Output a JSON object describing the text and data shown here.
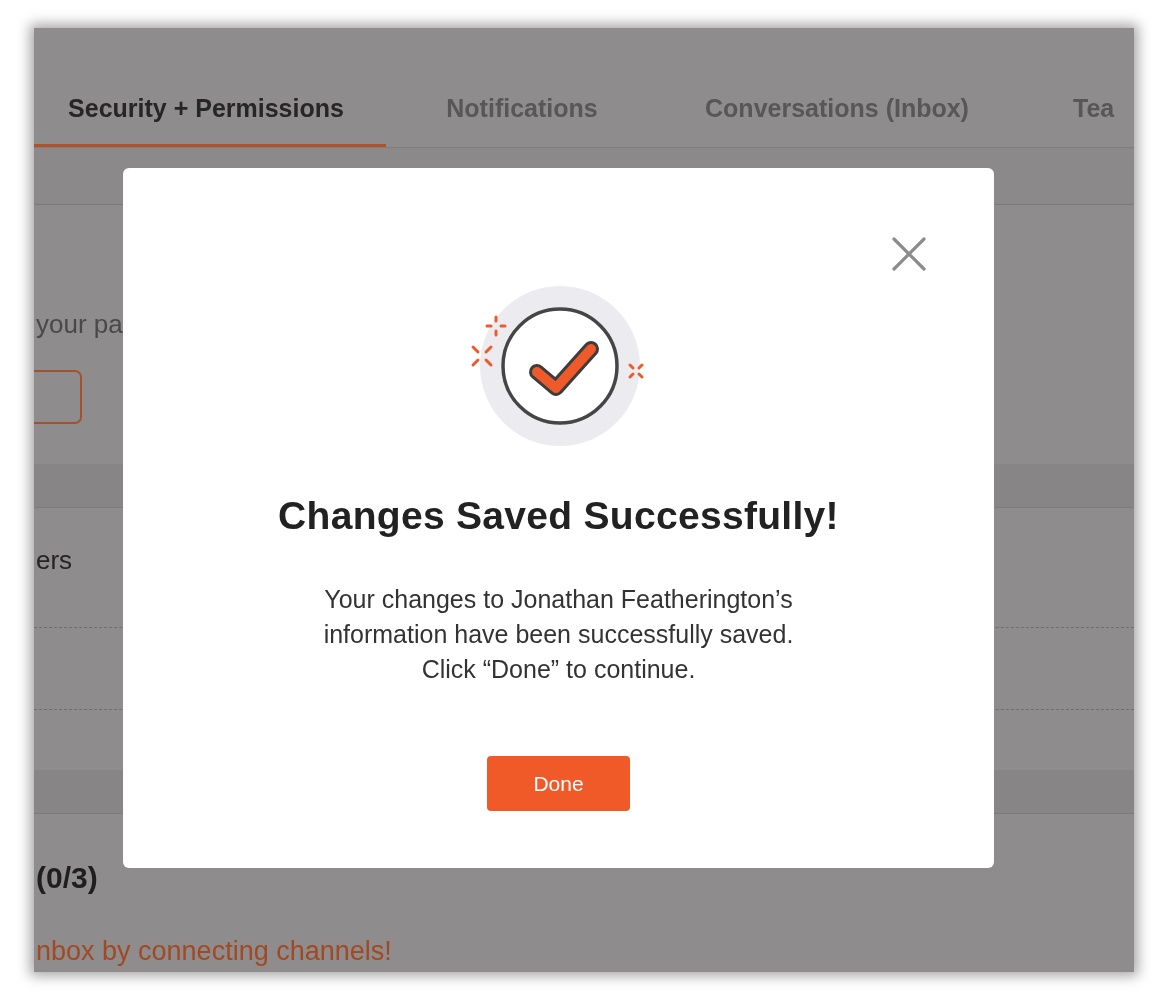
{
  "tabs": [
    {
      "label": "Security + Permissions",
      "selected": true
    },
    {
      "label": "Notifications",
      "selected": false
    },
    {
      "label": "Conversations (Inbox)",
      "selected": false
    },
    {
      "label": "Tea",
      "selected": false
    }
  ],
  "page_sections": [
    {
      "kind": "description",
      "text": "your pa"
    },
    {
      "kind": "list",
      "title": "ers"
    },
    {
      "kind": "channels",
      "title": "(0/3)",
      "link": "nbox by connecting channels!"
    }
  ],
  "modal": {
    "title": "Changes Saved Successfully!",
    "message": "Your changes to Jonathan Featherington’s\ninformation have been successfully saved.\nClick “Done” to continue.",
    "button": "Done"
  }
}
